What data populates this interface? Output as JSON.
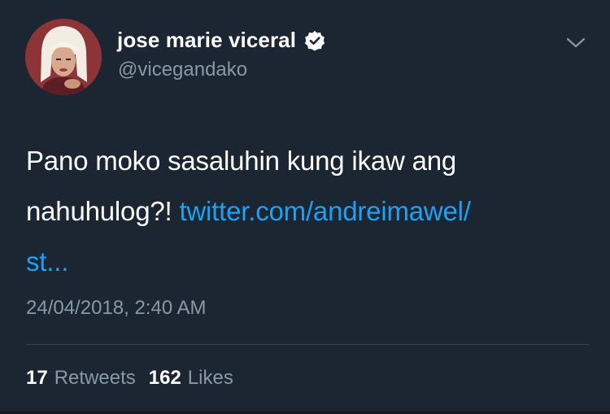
{
  "author": {
    "display_name": "jose marie viceral",
    "handle": "@vicegandako",
    "verified": true
  },
  "tweet": {
    "text_line1": "Pano moko sasaluhin kung ikaw ang",
    "text_line2_plain": "nahuhulog?! ",
    "link_part1": "twitter.com/andreimawel/",
    "link_part2": "st...",
    "timestamp": "24/04/2018, 2:40 AM"
  },
  "stats": {
    "retweets_count": "17",
    "retweets_label": "Retweets",
    "likes_count": "162",
    "likes_label": "Likes"
  },
  "icons": {
    "verified": "verified-badge-icon",
    "menu": "chevron-down-icon"
  },
  "colors": {
    "background": "#1c2532",
    "link": "#1da1f2",
    "secondary_text": "#8899a6"
  }
}
